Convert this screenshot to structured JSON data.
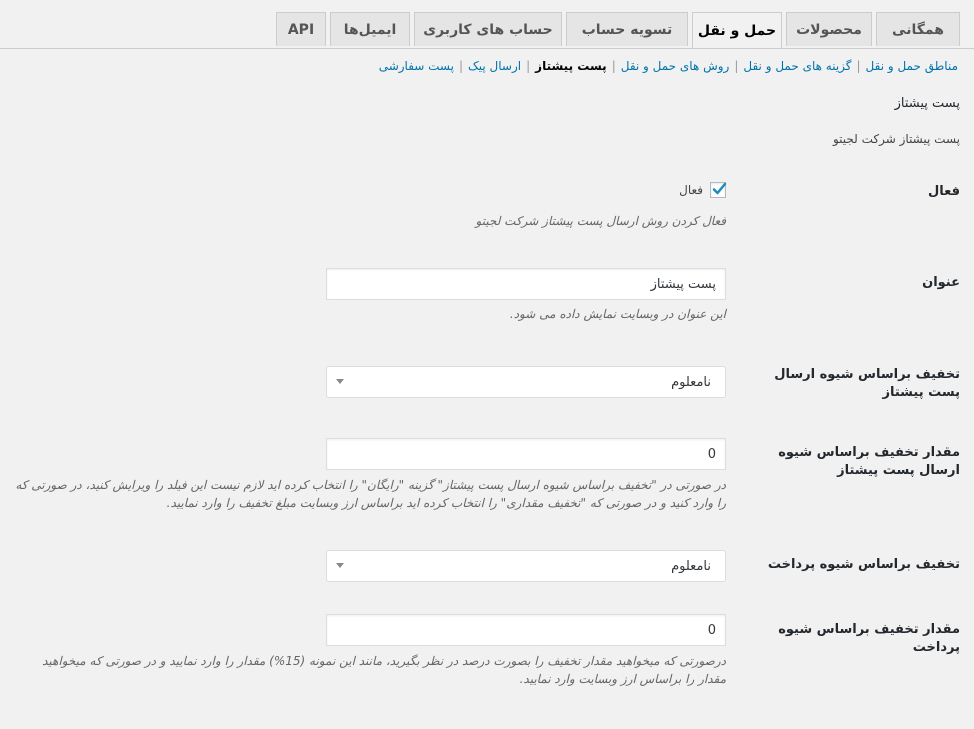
{
  "tabs": [
    {
      "label": "همگانی"
    },
    {
      "label": "محصولات"
    },
    {
      "label": "حمل و نقل"
    },
    {
      "label": "تسویه حساب"
    },
    {
      "label": "حساب های کاربری"
    },
    {
      "label": "ایمیل‌ها"
    },
    {
      "label": "API"
    }
  ],
  "subnav": {
    "items": [
      "مناطق حمل و نقل",
      "گزینه های حمل و نقل",
      "روش های حمل و نقل",
      "پست پیشتاز",
      "ارسال پیک",
      "پست سفارشی"
    ],
    "separator": "|"
  },
  "section": {
    "title": "پست پیشتاز",
    "description": "پست پیشتاز شرکت لجیتو"
  },
  "fields": {
    "enabled": {
      "label": "فعال",
      "checkbox_label": "فعال",
      "checked": true,
      "description": "فعال کردن روش ارسال پست پیشتاز شرکت لجیتو"
    },
    "title": {
      "label": "عنوان",
      "value": "پست پیشتاز",
      "description": "این عنوان در وبسایت نمایش داده می شود."
    },
    "discount_method": {
      "label": "تخفیف براساس شیوه ارسال پست پیشتاز",
      "selected": "نامعلوم"
    },
    "discount_amount": {
      "label": "مقدار تخفیف براساس شیوه ارسال پست پیشتاز",
      "value": "0",
      "description_line1": "در صورتی در \"تخفیف براساس شیوه ارسال پست پیشتاز\" گزینه \"رایگان\" را انتخاب کرده اید لازم نیست این فیلد را ویرایش کنید، در صورتی که",
      "description_line2": "را وارد کنید و در صورتی که \"تخفیف مقداری\" را انتخاب کرده اید براساس ارز وبسایت مبلغ تخفیف را وارد نمایید."
    },
    "payment_discount": {
      "label": "تخفیف براساس شیوه پرداخت",
      "selected": "نامعلوم"
    },
    "payment_discount_amount": {
      "label": "مقدار تخفیف براساس شیوه پرداخت",
      "value": "0",
      "description_line1": "درصورتی که میخواهید مقدار تخفیف را بصورت درصد در نظر بگیرید، مانند این نمونه (15%) مقدار را وارد نمایید و در صورتی که میخواهید",
      "description_line2": "مقدار را براساس ارز وبسایت وارد نمایید."
    }
  },
  "colors": {
    "link": "#0073aa",
    "check": "#1e8cbe",
    "background": "#f1f1f1"
  }
}
